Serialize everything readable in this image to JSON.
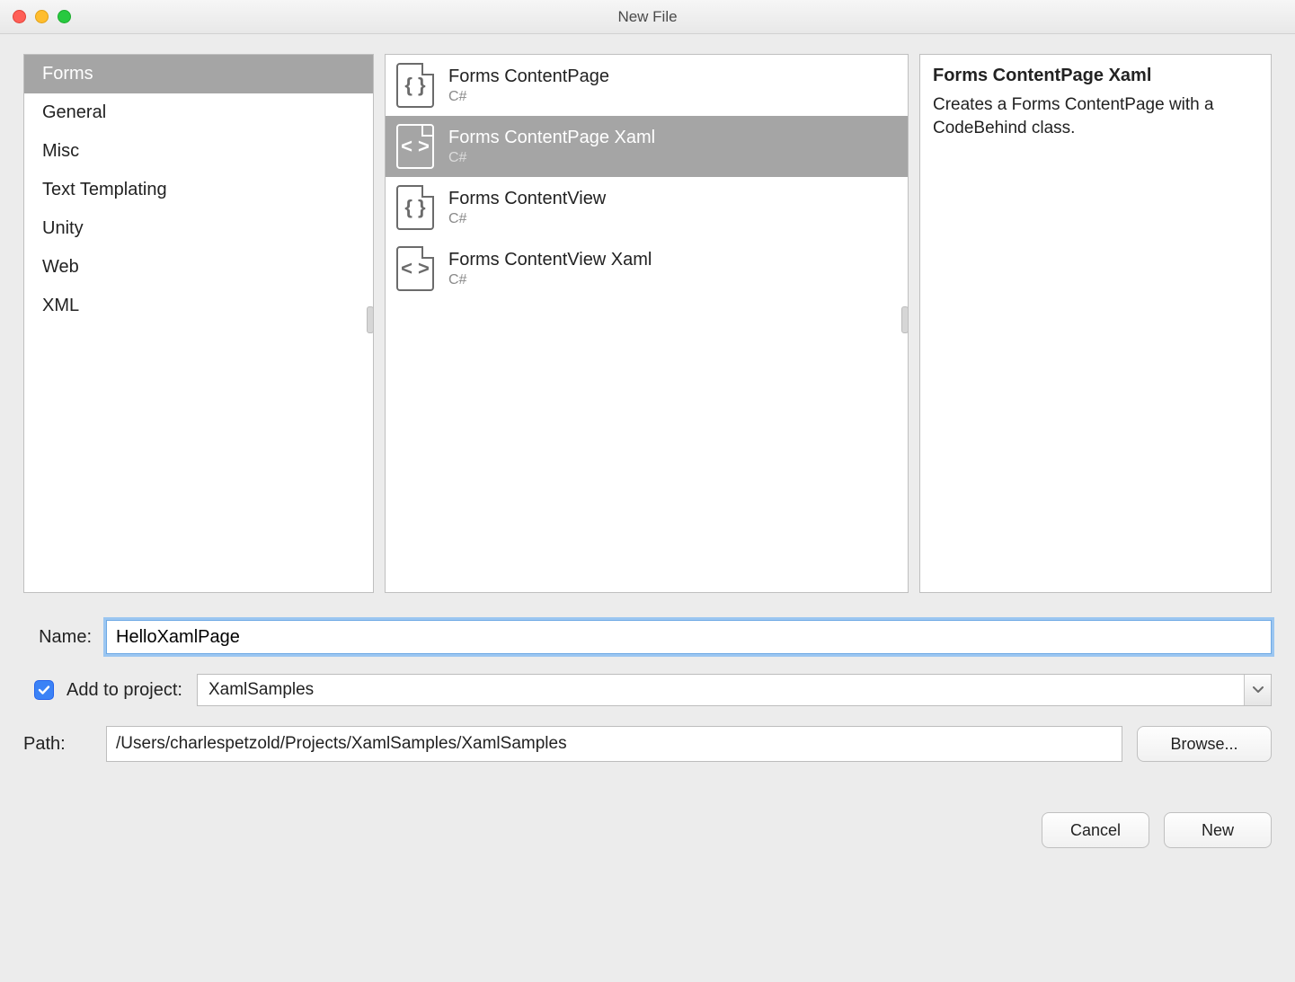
{
  "window": {
    "title": "New File"
  },
  "categories": {
    "items": [
      {
        "label": "Forms",
        "selected": true
      },
      {
        "label": "General",
        "selected": false
      },
      {
        "label": "Misc",
        "selected": false
      },
      {
        "label": "Text Templating",
        "selected": false
      },
      {
        "label": "Unity",
        "selected": false
      },
      {
        "label": "Web",
        "selected": false
      },
      {
        "label": "XML",
        "selected": false
      }
    ]
  },
  "templates": {
    "items": [
      {
        "name": "Forms ContentPage",
        "sub": "C#",
        "glyph": "{ }",
        "selected": false
      },
      {
        "name": "Forms ContentPage Xaml",
        "sub": "C#",
        "glyph": "< >",
        "selected": true
      },
      {
        "name": "Forms ContentView",
        "sub": "C#",
        "glyph": "{ }",
        "selected": false
      },
      {
        "name": "Forms ContentView Xaml",
        "sub": "C#",
        "glyph": "< >",
        "selected": false
      }
    ]
  },
  "description": {
    "title": "Forms ContentPage Xaml",
    "body": "Creates a Forms ContentPage with a CodeBehind class."
  },
  "form": {
    "name_label": "Name:",
    "name_value": "HelloXamlPage",
    "add_to_project_label": "Add to project:",
    "add_to_project_checked": true,
    "project_value": "XamlSamples",
    "path_label": "Path:",
    "path_value": "/Users/charlespetzold/Projects/XamlSamples/XamlSamples",
    "browse_label": "Browse..."
  },
  "footer": {
    "cancel_label": "Cancel",
    "new_label": "New"
  }
}
